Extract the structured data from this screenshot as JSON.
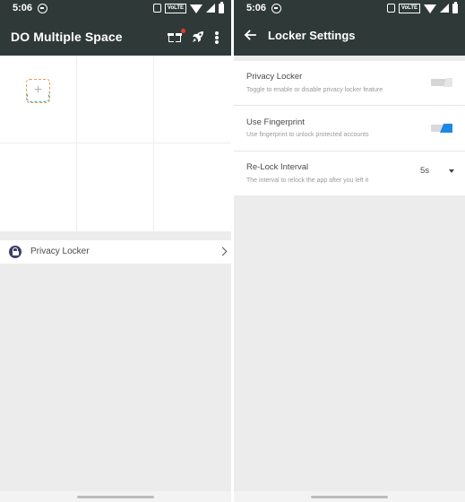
{
  "left": {
    "status": {
      "time": "5:06",
      "network_badge": "VoLTE"
    },
    "appbar": {
      "title": "DO Multiple Space"
    },
    "grid": {
      "add_symbol": "+"
    },
    "list": {
      "privacy_locker_label": "Privacy Locker"
    }
  },
  "right": {
    "status": {
      "time": "5:06",
      "network_badge": "VoLTE"
    },
    "appbar": {
      "title": "Locker Settings"
    },
    "settings": {
      "items": [
        {
          "title": "Privacy Locker",
          "subtitle": "Toggle to enable or disable privacy locker feature",
          "toggle": "off"
        },
        {
          "title": "Use Fingerprint",
          "subtitle": "Use fingerprint to unlock protected accounts",
          "toggle": "on"
        },
        {
          "title": "Re-Lock Interval",
          "subtitle": "The interval to relock the app after you left it",
          "value": "5s"
        }
      ]
    }
  },
  "colors": {
    "appbar": "#2f3a38",
    "accent": "#1e88e5",
    "badge": "#e53935"
  },
  "icons": [
    "gift-icon",
    "rocket-icon",
    "more-vert-icon",
    "lock-icon",
    "chevron-right-icon",
    "back-arrow-icon",
    "dropdown-caret-icon"
  ]
}
